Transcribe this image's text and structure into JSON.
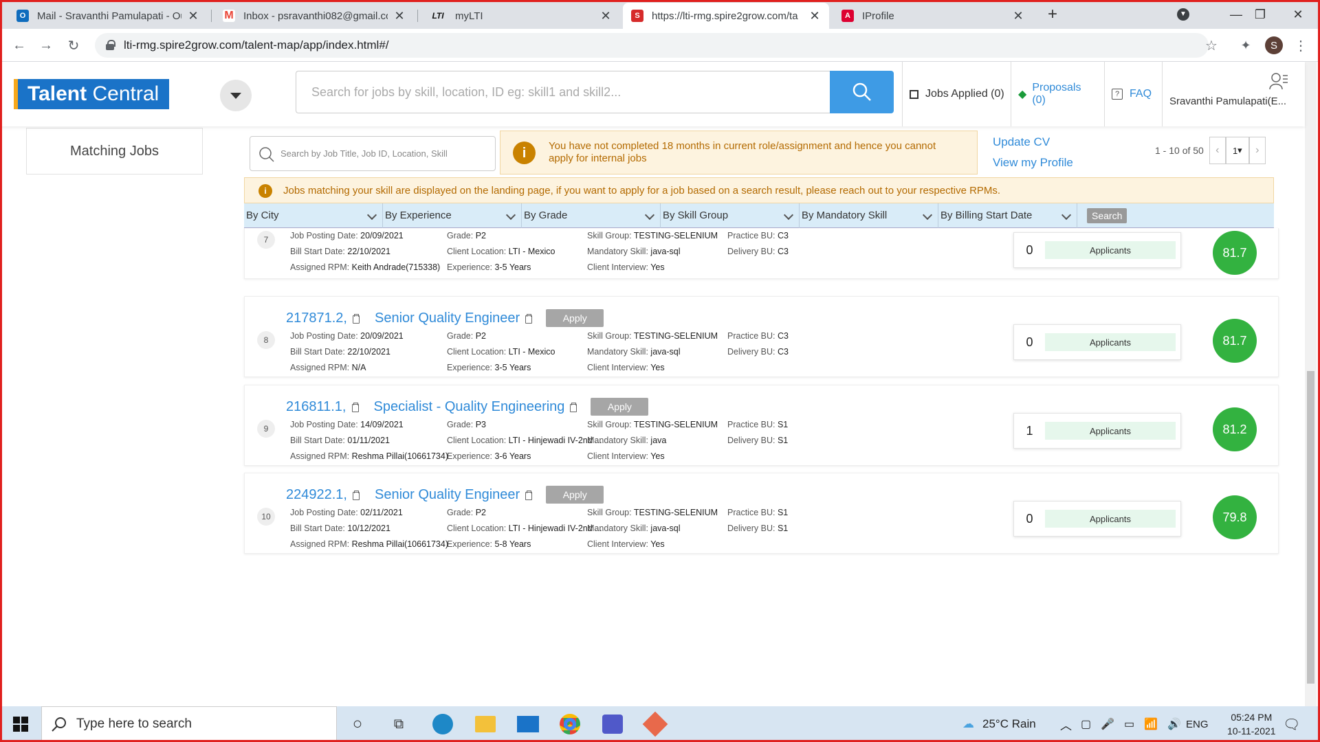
{
  "browser": {
    "tabs": [
      {
        "title": "Mail - Sravanthi Pamulapati - Out",
        "favicon_color": "#0f6cbd",
        "favicon_text": "O"
      },
      {
        "title": "Inbox - psravanthi082@gmail.com",
        "favicon_color": "#ea4335",
        "favicon_text": "M"
      },
      {
        "title": "myLTI",
        "favicon_color": "#ffffff",
        "favicon_text": "LTI"
      },
      {
        "title": "https://lti-rmg.spire2grow.com/ta",
        "favicon_color": "#d62b2b",
        "favicon_text": "S"
      },
      {
        "title": "IProfile",
        "favicon_color": "#dd0031",
        "favicon_text": "A"
      }
    ],
    "url": "lti-rmg.spire2grow.com/talent-map/app/index.html#/",
    "profile_initial": "S"
  },
  "header": {
    "logo_text_bold": "Talent",
    "logo_text": "Central",
    "search_placeholder": "Search for jobs by skill, location, ID eg: skill1 and skill2...",
    "jobs_applied": "Jobs Applied (0)",
    "proposals": "Proposals (0)",
    "faq": "FAQ",
    "user": "Sravanthi Pamulapati(E..."
  },
  "left": {
    "matching_jobs": "Matching Jobs"
  },
  "toolbar": {
    "filter_placeholder": "Search by Job Title, Job ID, Location, Skill",
    "warning": "You have not completed 18 months in current role/assignment and hence you cannot apply for internal jobs",
    "update_cv": "Update CV",
    "view_profile": "View my Profile",
    "range": "1 - 10 of 50",
    "page": "1",
    "note": "Jobs matching your skill are displayed on the landing page, if you want to apply for a job based on a search result, please reach out to your respective RPMs."
  },
  "filters": [
    "By City",
    "By Experience",
    "By Grade",
    "By Skill Group",
    "By Mandatory Skill",
    "By Billing Start Date"
  ],
  "filter_search": "Search",
  "labels": {
    "posting": "Job Posting Date:",
    "bill": "Bill Start Date:",
    "rpm": "Assigned RPM:",
    "grade": "Grade:",
    "location": "Client Location:",
    "experience": "Experience:",
    "skill_group": "Skill Group:",
    "mandatory": "Mandatory Skill:",
    "interview": "Client Interview:",
    "practice": "Practice BU:",
    "delivery": "Delivery BU:",
    "applicants": "Applicants",
    "apply": "Apply"
  },
  "jobs": [
    {
      "n": "7",
      "id": "",
      "title": "",
      "posting": "20/09/2021",
      "bill": "22/10/2021",
      "rpm": "Keith Andrade(715338)",
      "grade": "P2",
      "location": "LTI - Mexico",
      "experience": "3-5 Years",
      "skill_group": "TESTING-SELENIUM",
      "mandatory": "java-sql",
      "interview": "Yes",
      "practice": "C3",
      "delivery": "C3",
      "applicants": "0",
      "score": "81.7"
    },
    {
      "n": "8",
      "id": "217871.2,",
      "title": "Senior Quality Engineer",
      "posting": "20/09/2021",
      "bill": "22/10/2021",
      "rpm": "N/A",
      "grade": "P2",
      "location": "LTI - Mexico",
      "experience": "3-5 Years",
      "skill_group": "TESTING-SELENIUM",
      "mandatory": "java-sql",
      "interview": "Yes",
      "practice": "C3",
      "delivery": "C3",
      "applicants": "0",
      "score": "81.7"
    },
    {
      "n": "9",
      "id": "216811.1,",
      "title": "Specialist - Quality Engineering",
      "posting": "14/09/2021",
      "bill": "01/11/2021",
      "rpm": "Reshma Pillai(10661734)",
      "grade": "P3",
      "location": "LTI - Hinjewadi IV-2nd ...",
      "experience": "3-6 Years",
      "skill_group": "TESTING-SELENIUM",
      "mandatory": "java",
      "interview": "Yes",
      "practice": "S1",
      "delivery": "S1",
      "applicants": "1",
      "score": "81.2"
    },
    {
      "n": "10",
      "id": "224922.1,",
      "title": "Senior Quality Engineer",
      "posting": "02/11/2021",
      "bill": "10/12/2021",
      "rpm": "Reshma Pillai(10661734)",
      "grade": "P2",
      "location": "LTI - Hinjewadi IV-2nd ...",
      "experience": "5-8 Years",
      "skill_group": "TESTING-SELENIUM",
      "mandatory": "java-sql",
      "interview": "Yes",
      "practice": "S1",
      "delivery": "S1",
      "applicants": "0",
      "score": "79.8"
    }
  ],
  "taskbar": {
    "search_placeholder": "Type here to search",
    "weather": "25°C  Rain",
    "lang": "ENG",
    "time": "05:24 PM",
    "date": "10-11-2021"
  },
  "colors": {
    "accent": "#2f8ad8",
    "score_green": "#33b240",
    "warning": "#b36a00"
  }
}
